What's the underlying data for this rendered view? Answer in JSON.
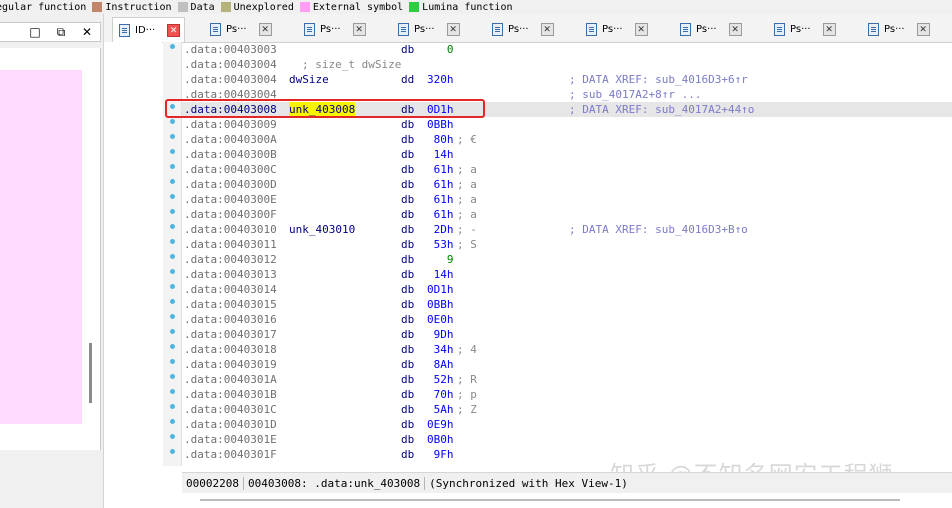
{
  "legend": [
    {
      "label": "egular function",
      "color": "#c0c0c0"
    },
    {
      "label": "Instruction",
      "color": "#c0856a"
    },
    {
      "label": "Data",
      "color": "#c0c0c0"
    },
    {
      "label": "Unexplored",
      "color": "#b5b37a"
    },
    {
      "label": "External symbol",
      "color": "#ff9ef4"
    },
    {
      "label": "Lumina function",
      "color": "#2ecc40"
    }
  ],
  "left_panel": {
    "buttons": [
      "□",
      "⧉",
      "✕"
    ]
  },
  "tabs": [
    {
      "label": "ID···",
      "active": true
    },
    {
      "label": "Ps···",
      "active": false
    },
    {
      "label": "Ps···",
      "active": false
    },
    {
      "label": "Ps···",
      "active": false
    },
    {
      "label": "Ps···",
      "active": false
    },
    {
      "label": "Ps···",
      "active": false
    },
    {
      "label": "Ps···",
      "active": false
    },
    {
      "label": "Ps···",
      "active": false
    },
    {
      "label": "Ps···",
      "active": false
    }
  ],
  "tab_close_label": "✕",
  "listing": [
    {
      "addr": ".data:00403003",
      "label": "",
      "mnem": "db",
      "operand": "   0",
      "comment": "",
      "xref": "",
      "dot": true
    },
    {
      "addr": ".data:00403004",
      "label": "; size_t dwSize",
      "mnem": "",
      "operand": "",
      "comment": "",
      "xref": "",
      "dot": false
    },
    {
      "addr": ".data:00403004",
      "label": "dwSize",
      "mnem": "dd",
      "operand": "320h",
      "comment": "",
      "xref": "; DATA XREF: sub_4016D3+6↑r",
      "dot": false
    },
    {
      "addr": ".data:00403004",
      "label": "",
      "mnem": "",
      "operand": "",
      "comment": "",
      "xref": "; sub_4017A2+8↑r ...",
      "dot": false
    },
    {
      "addr": ".data:00403008",
      "label": "unk_403008",
      "mnem": "db",
      "operand": "0D1h",
      "comment": "",
      "xref": "; DATA XREF: sub_4017A2+44↑o",
      "dot": true,
      "selected": true
    },
    {
      "addr": ".data:00403009",
      "label": "",
      "mnem": "db",
      "operand": "0BBh",
      "comment": "",
      "xref": "",
      "dot": true
    },
    {
      "addr": ".data:0040300A",
      "label": "",
      "mnem": "db",
      "operand": " 80h",
      "comment": "; €",
      "xref": "",
      "dot": true
    },
    {
      "addr": ".data:0040300B",
      "label": "",
      "mnem": "db",
      "operand": " 14h",
      "comment": "",
      "xref": "",
      "dot": true
    },
    {
      "addr": ".data:0040300C",
      "label": "",
      "mnem": "db",
      "operand": " 61h",
      "comment": "; a",
      "xref": "",
      "dot": true
    },
    {
      "addr": ".data:0040300D",
      "label": "",
      "mnem": "db",
      "operand": " 61h",
      "comment": "; a",
      "xref": "",
      "dot": true
    },
    {
      "addr": ".data:0040300E",
      "label": "",
      "mnem": "db",
      "operand": " 61h",
      "comment": "; a",
      "xref": "",
      "dot": true
    },
    {
      "addr": ".data:0040300F",
      "label": "",
      "mnem": "db",
      "operand": " 61h",
      "comment": "; a",
      "xref": "",
      "dot": true
    },
    {
      "addr": ".data:00403010",
      "label": "unk_403010",
      "mnem": "db",
      "operand": " 2Dh",
      "comment": "; -",
      "xref": "; DATA XREF: sub_4016D3+B↑o",
      "dot": true
    },
    {
      "addr": ".data:00403011",
      "label": "",
      "mnem": "db",
      "operand": " 53h",
      "comment": "; S",
      "xref": "",
      "dot": true
    },
    {
      "addr": ".data:00403012",
      "label": "",
      "mnem": "db",
      "operand": "   9",
      "comment": "",
      "xref": "",
      "dot": true
    },
    {
      "addr": ".data:00403013",
      "label": "",
      "mnem": "db",
      "operand": " 14h",
      "comment": "",
      "xref": "",
      "dot": true
    },
    {
      "addr": ".data:00403014",
      "label": "",
      "mnem": "db",
      "operand": "0D1h",
      "comment": "",
      "xref": "",
      "dot": true
    },
    {
      "addr": ".data:00403015",
      "label": "",
      "mnem": "db",
      "operand": "0BBh",
      "comment": "",
      "xref": "",
      "dot": true
    },
    {
      "addr": ".data:00403016",
      "label": "",
      "mnem": "db",
      "operand": "0E0h",
      "comment": "",
      "xref": "",
      "dot": true
    },
    {
      "addr": ".data:00403017",
      "label": "",
      "mnem": "db",
      "operand": " 9Dh",
      "comment": "",
      "xref": "",
      "dot": true
    },
    {
      "addr": ".data:00403018",
      "label": "",
      "mnem": "db",
      "operand": " 34h",
      "comment": "; 4",
      "xref": "",
      "dot": true
    },
    {
      "addr": ".data:00403019",
      "label": "",
      "mnem": "db",
      "operand": " 8Ah",
      "comment": "",
      "xref": "",
      "dot": true
    },
    {
      "addr": ".data:0040301A",
      "label": "",
      "mnem": "db",
      "operand": " 52h",
      "comment": "; R",
      "xref": "",
      "dot": true
    },
    {
      "addr": ".data:0040301B",
      "label": "",
      "mnem": "db",
      "operand": " 70h",
      "comment": "; p",
      "xref": "",
      "dot": true
    },
    {
      "addr": ".data:0040301C",
      "label": "",
      "mnem": "db",
      "operand": " 5Ah",
      "comment": "; Z",
      "xref": "",
      "dot": true
    },
    {
      "addr": ".data:0040301D",
      "label": "",
      "mnem": "db",
      "operand": "0E9h",
      "comment": "",
      "xref": "",
      "dot": true
    },
    {
      "addr": ".data:0040301E",
      "label": "",
      "mnem": "db",
      "operand": "0B0h",
      "comment": "",
      "xref": "",
      "dot": true
    },
    {
      "addr": ".data:0040301F",
      "label": "",
      "mnem": "db",
      "operand": " 9Fh",
      "comment": "",
      "xref": "",
      "dot": true
    }
  ],
  "highlighted_label": "unk_403008",
  "watermark": "知乎 @不知名网安工程狮",
  "status_bar": {
    "offset": "00002208",
    "location": "00403008: .data:unk_403008",
    "sync": "(Synchronized with Hex View-1)"
  },
  "colors": {
    "selection_box": "#e32626",
    "label_highlight": "#f8f400",
    "graph_marker": "#4fb6e2"
  }
}
